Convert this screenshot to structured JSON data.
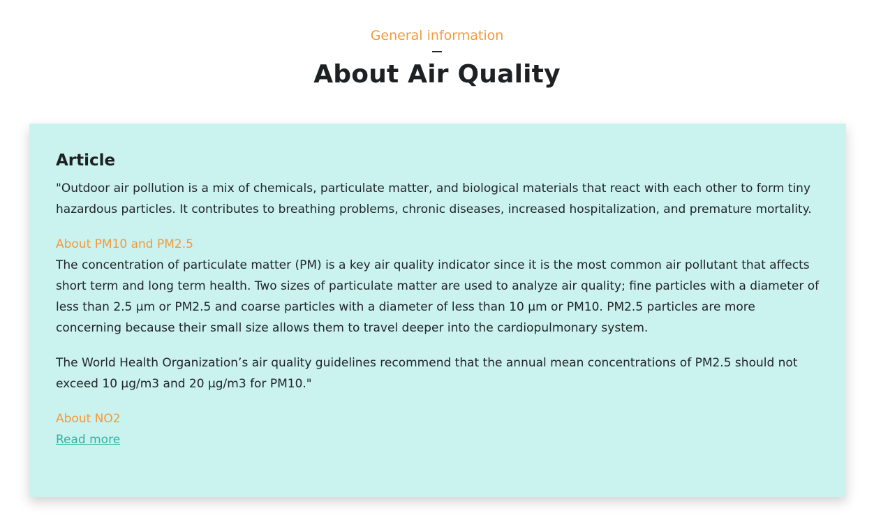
{
  "header": {
    "eyebrow": "General information",
    "title": "About Air Quality"
  },
  "article": {
    "heading": "Article",
    "intro": "\"Outdoor air pollution is a mix of chemicals, particulate matter, and biological materials that react with each other to form tiny hazardous particles. It contributes to breathing problems, chronic diseases, increased hospitalization, and premature mortality.",
    "pm_heading": "About PM10 and PM2.5",
    "pm_paragraph_1": "The concentration of particulate matter (PM) is a key air quality indicator since it is the most common air pollutant that affects short term and long term health. Two sizes of particulate matter are used to analyze air quality; fine particles with a diameter of less than 2.5 μm or PM2.5 and coarse particles with a diameter of less than 10 μm or PM10. PM2.5 particles are more concerning because their small size allows them to travel deeper into the cardiopulmonary system.",
    "pm_paragraph_2": "The World Health Organization’s air quality guidelines recommend that the annual mean concentrations of PM2.5 should not exceed 10 μg/m3 and 20 μg/m3 for PM10.\"",
    "no2_heading": "About NO2",
    "read_more_label": "Read more"
  },
  "colors": {
    "accent": "#f39a3c",
    "card_background": "#caf2ee",
    "link": "#2fb3a3"
  }
}
